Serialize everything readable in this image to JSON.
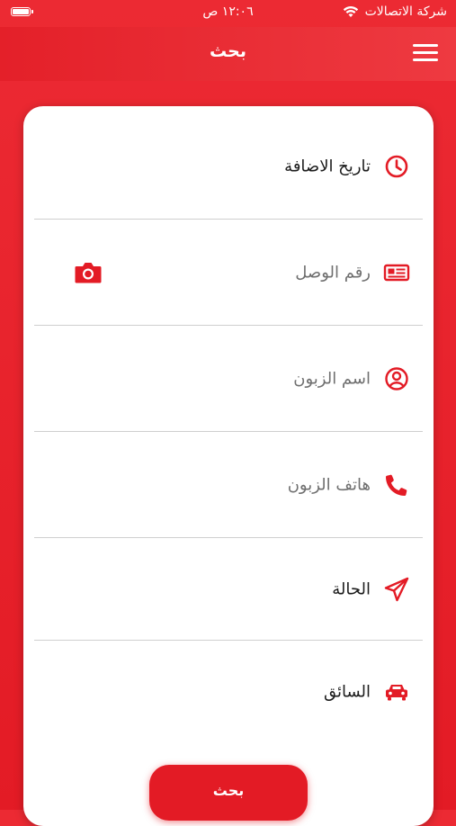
{
  "status_bar": {
    "carrier": "شركة الاتصالات",
    "time": "١٢:٠٦ ص"
  },
  "header": {
    "title": "بحث",
    "menu_icon": "hamburger-menu-icon"
  },
  "form": {
    "rows": [
      {
        "label": "تاريخ الاضافة",
        "icon": "clock-icon"
      },
      {
        "label": "رقم الوصل",
        "icon": "receipt-icon",
        "action_icon": "camera-icon"
      },
      {
        "label": "اسم الزبون",
        "icon": "user-circle-icon"
      },
      {
        "label": "هاتف الزبون",
        "icon": "phone-icon"
      },
      {
        "label": "الحالة",
        "icon": "paper-plane-icon"
      },
      {
        "label": "السائق",
        "icon": "car-icon"
      }
    ]
  },
  "search_button": {
    "label": "بحث"
  },
  "colors": {
    "accent": "#e31b25",
    "white": "#ffffff",
    "text_dark": "#1c1c1c",
    "text_muted": "#6f6f6f",
    "divider": "#cfcfcf"
  }
}
